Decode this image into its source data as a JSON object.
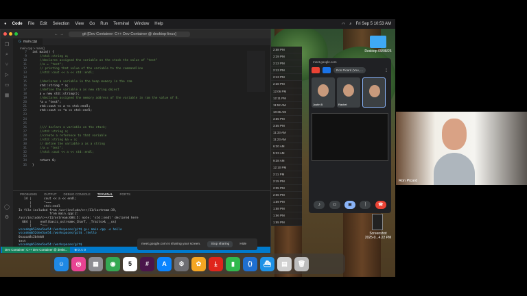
{
  "menubar": {
    "app": "Code",
    "items": [
      "File",
      "Edit",
      "Selection",
      "View",
      "Go",
      "Run",
      "Terminal",
      "Window",
      "Help"
    ],
    "datetime": "Fri Sep 5  10:53 AM"
  },
  "vscode": {
    "search": "git [Dev Container: C++ Dev Container @ desktop-linux]",
    "tab": "main.cpp",
    "breadcrumb": "main.cpp  >  main()",
    "code_lines": [
      {
        "n": "7",
        "t": "int main() {",
        "c": false
      },
      {
        "n": "9",
        "t": "    //std::string a;",
        "c": true
      },
      {
        "n": "10",
        "t": "    //declares assigned the variable on the stack the value of \"test\"",
        "c": true
      },
      {
        "n": "11",
        "t": "    //a = \"test\";",
        "c": true
      },
      {
        "n": "12",
        "t": "    // printing that value of the variable to the commandline",
        "c": true
      },
      {
        "n": "13",
        "t": "    //std::cout << a << std::endl;",
        "c": true
      },
      {
        "n": "14",
        "t": "",
        "c": false
      },
      {
        "n": "15",
        "t": "    //declares a variable in the heap memory in the ram",
        "c": true
      },
      {
        "n": "16",
        "t": "    std::string * a;",
        "c": false
      },
      {
        "n": "17",
        "t": "    //define the variable a as new string object",
        "c": true
      },
      {
        "n": "18",
        "t": "    a = new std::string();",
        "c": false
      },
      {
        "n": "19",
        "t": "    //declares assigned the memory address of the variable in ram the value of 8.",
        "c": true
      },
      {
        "n": "20",
        "t": "    *a = \"test\";",
        "c": false
      },
      {
        "n": "21",
        "t": "    std::cout << a << std::endl;",
        "c": false
      },
      {
        "n": "22",
        "t": "    std::cout << *a << std::endl;",
        "c": false
      },
      {
        "n": "23",
        "t": "",
        "c": false
      },
      {
        "n": "24",
        "t": "",
        "c": false
      },
      {
        "n": "25",
        "t": "",
        "c": false
      },
      {
        "n": "26",
        "t": "    //// declare a variable on the stack;",
        "c": true
      },
      {
        "n": "27",
        "t": "    //std::string a;",
        "c": true
      },
      {
        "n": "28",
        "t": "    //create a reference to that variable",
        "c": true
      },
      {
        "n": "29",
        "t": "    //std::string &a = a;",
        "c": true
      },
      {
        "n": "30",
        "t": "    // define the variable a as a string",
        "c": true
      },
      {
        "n": "31",
        "t": "    //a = \"test\";",
        "c": true
      },
      {
        "n": "32",
        "t": "    //std::cout << a << std::endl;",
        "c": true
      },
      {
        "n": "33",
        "t": "",
        "c": false
      },
      {
        "n": "34",
        "t": "    return 0;",
        "c": false
      },
      {
        "n": "35",
        "t": "}",
        "c": false
      }
    ],
    "panel_tabs": [
      "PROBLEMS",
      "OUTPUT",
      "DEBUG CONSOLE",
      "TERMINAL",
      "PORTS"
    ],
    "terminal_lines": [
      "   14 |       cout << a << endl;",
      "      |       ^~~~",
      "      |       std::endl",
      "In file included from /usr/include/c++/11/iostream:39,",
      "                 from main.cpp:2:",
      "/usr/include/c++/11/ostream:684:5: note: 'std::endl' declared here",
      "  684 |     endl(basic_ostream<_CharT, _Traits>& __os)",
      "      |     ^~~~",
      "vscode@b52dee5ae54:/workspaces/git$ g++ main.cpp -o hello",
      "vscode@b52dee5ae54:/workspaces/git$ ./hello",
      "0xaaaa8c2b4eb0",
      "test",
      "vscode@b52dee5ae54:/workspaces/git$ "
    ],
    "status_remote": "Dev Container: C++ Dev Container @ deskt...",
    "status_items": "⊗ 0  ⚠ 0"
  },
  "finder_times": [
    "2:58 PM",
    "2:29 PM",
    "2:13 PM",
    "2:13 PM",
    "2:13 PM",
    "2:28 PM",
    "12:06 PM",
    "12:11 PM",
    "11:52 AM",
    "10:36 AM",
    "3:55 PM",
    "3:55 PM",
    "11:33 AM",
    "11:23 AM",
    "6:20 AM",
    "5:23 AM",
    "9:38 AM",
    "12:10 PM",
    "2:11 PM",
    "2:15 PM",
    "2:05 PM",
    "2:06 PM",
    "1:59 PM",
    "1:58 PM",
    "1:56 PM",
    "1:55 PM"
  ],
  "meet": {
    "url": "meet.google.com",
    "presenter": "Ron Picard (You, ...",
    "tiles": [
      "Justin B",
      "Rachel",
      ""
    ],
    "share_notice": "meet.google.com is sharing your screen.",
    "stop_label": "Stop sharing",
    "hide_label": "Hide"
  },
  "desktop": {
    "folder_label": "Desktop 09/08/25",
    "screenshot_label": "Screenshot\n2025-0...4.22 PM"
  },
  "dock_icons": [
    {
      "name": "finder",
      "glyph": "☺",
      "color": "#1e88e5"
    },
    {
      "name": "screenshot",
      "glyph": "◎",
      "color": "#e84393"
    },
    {
      "name": "launchpad",
      "glyph": "▦",
      "color": "#8e8e93"
    },
    {
      "name": "chrome",
      "glyph": "◉",
      "color": "#34a853"
    },
    {
      "name": "calendar",
      "glyph": "5",
      "color": "#ffffff"
    },
    {
      "name": "slack",
      "glyph": "#",
      "color": "#4a154b"
    },
    {
      "name": "app-store",
      "glyph": "A",
      "color": "#0a84ff"
    },
    {
      "name": "system-settings",
      "glyph": "⚙",
      "color": "#6e6e73"
    },
    {
      "name": "photos",
      "glyph": "✿",
      "color": "#f5a623"
    },
    {
      "name": "acrobat",
      "glyph": "⤓",
      "color": "#e0251b"
    },
    {
      "name": "numbers",
      "glyph": "▮",
      "color": "#30b94d"
    },
    {
      "name": "vscode",
      "glyph": "⟨⟩",
      "color": "#1f6fd0"
    },
    {
      "name": "docker",
      "glyph": "⛴",
      "color": "#1d91e6"
    },
    {
      "name": "downloads",
      "glyph": "▤",
      "color": "#d0d0d0"
    },
    {
      "name": "trash",
      "glyph": "🗑",
      "color": "#bdbdbd"
    }
  ],
  "calendar_month": "SEP",
  "video": {
    "name": "Ron Picard"
  }
}
